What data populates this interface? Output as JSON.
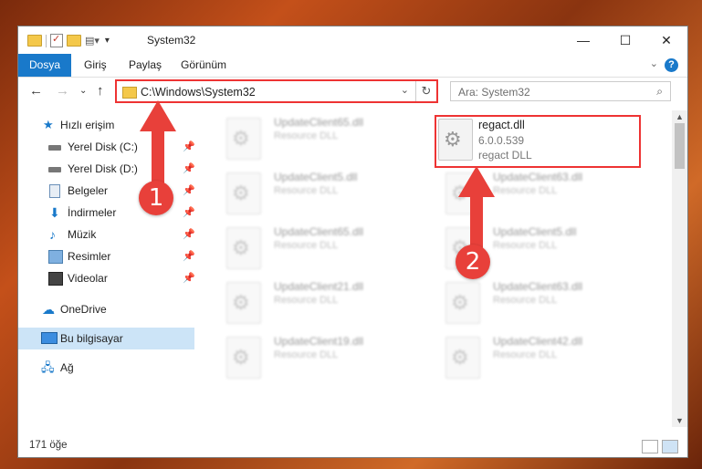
{
  "window": {
    "title": "System32",
    "controls": {
      "minimize": "—",
      "maximize": "☐",
      "close": "✕"
    }
  },
  "ribbon": {
    "tabs": [
      "Dosya",
      "Giriş",
      "Paylaş",
      "Görünüm"
    ],
    "help": "?"
  },
  "address": {
    "path": "C:\\Windows\\System32",
    "refresh": "↻",
    "dropdown": "⌄"
  },
  "search": {
    "placeholder": "Ara: System32"
  },
  "sidebar": {
    "quick_access": "Hızlı erişim",
    "items": [
      {
        "label": "Yerel Disk (C:)",
        "icon": "drive-icon"
      },
      {
        "label": "Yerel Disk (D:)",
        "icon": "drive-icon"
      },
      {
        "label": "Belgeler",
        "icon": "documents-icon"
      },
      {
        "label": "İndirmeler",
        "icon": "download-icon"
      },
      {
        "label": "Müzik",
        "icon": "music-icon"
      },
      {
        "label": "Resimler",
        "icon": "pictures-icon"
      },
      {
        "label": "Videolar",
        "icon": "videos-icon"
      }
    ],
    "onedrive": "OneDrive",
    "this_pc": "Bu bilgisayar",
    "network": "Ağ"
  },
  "files": {
    "left_column": [
      {
        "name": "UpdateClient65.dll",
        "type": "Resource DLL"
      },
      {
        "name": "UpdateClient5.dll",
        "type": "Resource DLL"
      },
      {
        "name": "UpdateClient65.dll",
        "type": "Resource DLL"
      },
      {
        "name": "UpdateClient21.dll",
        "type": "Resource DLL"
      },
      {
        "name": "UpdateClient19.dll",
        "type": "Resource DLL"
      }
    ],
    "highlighted": {
      "name": "regact.dll",
      "version": "6.0.0.539",
      "type": "regact DLL"
    },
    "right_column": [
      {
        "name": "UpdateClient63.dll",
        "type": "Resource DLL"
      },
      {
        "name": "UpdateClient5.dll",
        "type": "Resource DLL"
      },
      {
        "name": "UpdateClient63.dll",
        "type": "Resource DLL"
      },
      {
        "name": "UpdateClient42.dll",
        "type": "Resource DLL"
      }
    ]
  },
  "status": {
    "count": "171 öğe"
  },
  "annotations": {
    "step1": "1",
    "step2": "2",
    "color": "#e8403a"
  }
}
